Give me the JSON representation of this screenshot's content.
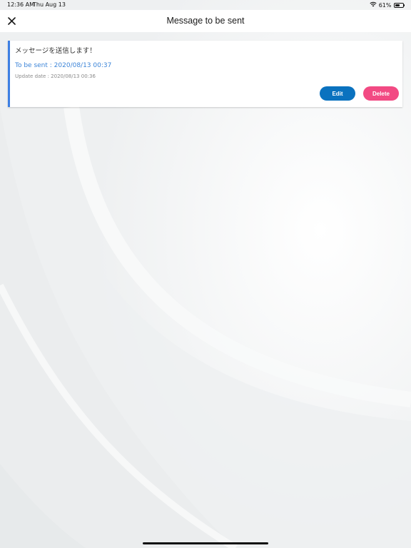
{
  "status_bar": {
    "time": "12:36 AM",
    "date": "Thu Aug 13",
    "battery_text": "61%",
    "battery_level": 0.61
  },
  "nav": {
    "title": "Message to be sent",
    "close_icon": "close-icon"
  },
  "message_card": {
    "message": "メッセージを送信します！",
    "to_be_sent": "To be sent : 2020/08/13 00:37",
    "update_date": "Update date : 2020/08/13 00:36",
    "edit_label": "Edit",
    "delete_label": "Delete"
  },
  "colors": {
    "accent_border": "#3d7fe3",
    "link_blue": "#3d85d8",
    "edit_button": "#0a72bf",
    "delete_button": "#f24a83",
    "background": "#f3f4f5"
  }
}
